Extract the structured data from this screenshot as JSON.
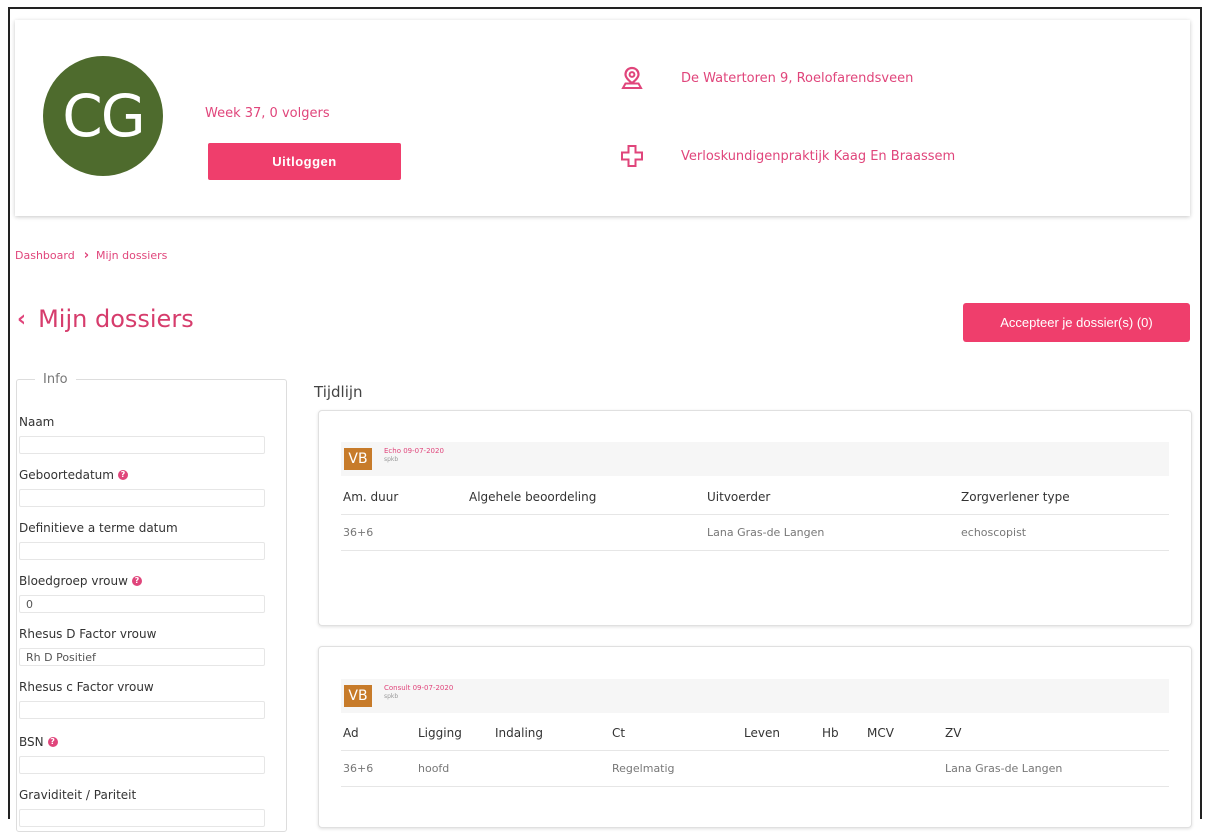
{
  "profile": {
    "initials": "CG",
    "week_text": "Week 37, 0 volgers",
    "logout_label": "Uitloggen",
    "address": "De Watertoren 9, Roelofarendsveen",
    "practice": "Verloskundigenpraktijk Kaag En Braassem",
    "address_icon": "location-pin-icon",
    "practice_icon": "medical-cross-icon"
  },
  "breadcrumb": {
    "home": "Dashboard",
    "current": "Mijn dossiers"
  },
  "page": {
    "title": "Mijn dossiers",
    "accept_button": "Accepteer je dossier(s) (0)"
  },
  "info_panel": {
    "legend": "Info",
    "fields": [
      {
        "label": "Naam",
        "value": "",
        "help": false
      },
      {
        "label": "Geboortedatum",
        "value": "",
        "help": true
      },
      {
        "label": "Definitieve a terme datum",
        "value": "",
        "help": false
      },
      {
        "label": "Bloedgroep vrouw",
        "value": "0",
        "help": true
      },
      {
        "label": "Rhesus D Factor vrouw",
        "value": "Rh D Positief",
        "help": false
      },
      {
        "label": "Rhesus c Factor vrouw",
        "value": "",
        "help": false
      },
      {
        "label": "BSN",
        "value": "",
        "help": true
      },
      {
        "label": "Graviditeit / Pariteit",
        "value": "",
        "help": false
      }
    ]
  },
  "timeline": {
    "label": "Tijdlijn",
    "entries": [
      {
        "badge": "VB",
        "title": "Echo 09-07-2020",
        "subtitle": "spkb",
        "headers": [
          "Am. duur",
          "Algehele beoordeling",
          "Uitvoerder",
          "Zorgverlener type"
        ],
        "values": [
          "36+6",
          "",
          "Lana Gras-de Langen",
          "echoscopist"
        ]
      },
      {
        "badge": "VB",
        "title": "Consult 09-07-2020",
        "subtitle": "spkb",
        "headers": [
          "Ad",
          "Ligging",
          "Indaling",
          "Ct",
          "Leven",
          "Hb",
          "MCV",
          "ZV"
        ],
        "values": [
          "36+6",
          "hoofd",
          "",
          "Regelmatig",
          "",
          "",
          "",
          "Lana Gras-de Langen"
        ]
      }
    ]
  },
  "colors": {
    "accent": "#ef3e6c",
    "link": "#e0457b",
    "avatar": "#4e6b2d",
    "badge": "#c77b2a"
  }
}
